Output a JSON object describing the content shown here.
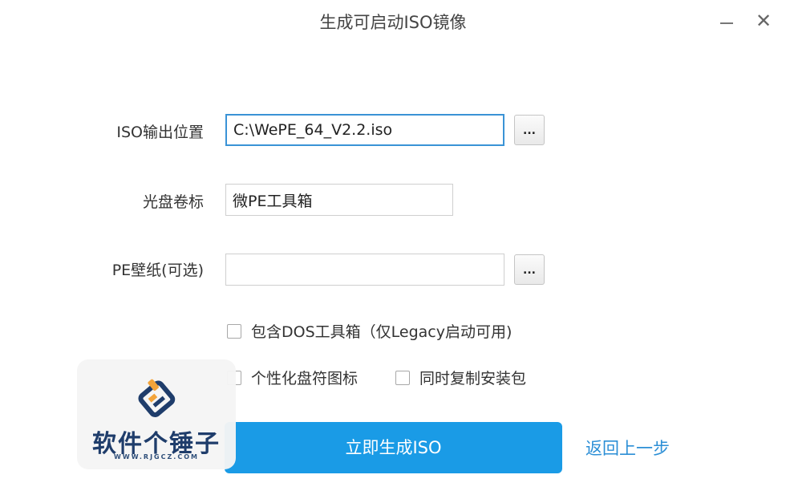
{
  "window": {
    "title": "生成可启动ISO镜像",
    "minimize_icon": "minimize-icon",
    "close_icon": "close-icon",
    "close_glyph": "✕"
  },
  "form": {
    "iso_output": {
      "label": "ISO输出位置",
      "value": "C:\\WePE_64_V2.2.iso",
      "browse_label": "..."
    },
    "volume_label": {
      "label": "光盘卷标",
      "value": "微PE工具箱"
    },
    "wallpaper": {
      "label": "PE壁纸(可选)",
      "value": "",
      "browse_label": "..."
    }
  },
  "options": {
    "include_dos": {
      "label": "包含DOS工具箱（仅Legacy启动可用)",
      "checked": false
    },
    "personalize_icon": {
      "label": "个性化盘符图标",
      "checked": false
    },
    "copy_installer": {
      "label": "同时复制安装包",
      "checked": false
    }
  },
  "actions": {
    "generate_label": "立即生成ISO",
    "back_label": "返回上一步"
  },
  "watermark": {
    "name": "软件个锤子",
    "url": "WWW.RJGCZ.COM",
    "logo_icon": "rjgcz-logo-icon"
  },
  "colors": {
    "accent": "#1a9be6",
    "link": "#2c8fd6",
    "focus_border": "#3a93d6",
    "watermark_orange": "#f3a43a",
    "watermark_blue": "#1f3d6b"
  }
}
